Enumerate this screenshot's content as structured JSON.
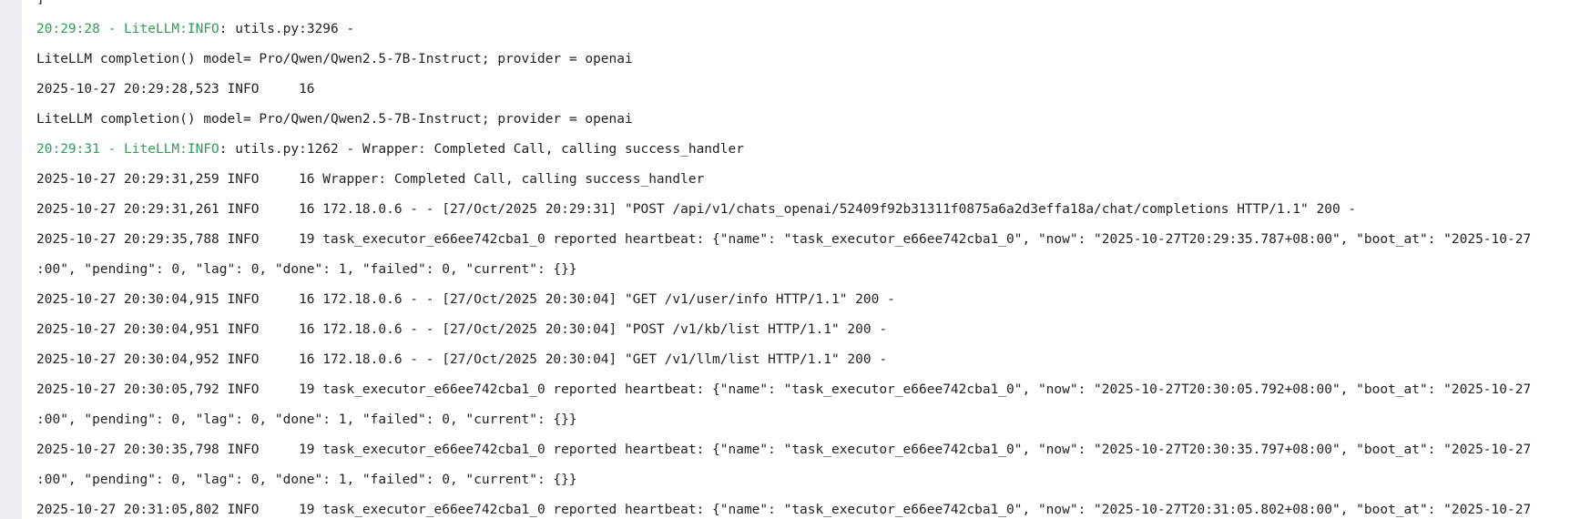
{
  "log": {
    "top_fragment": "]",
    "accent_color": "#2e9e5b",
    "lines": [
      {
        "prefix": "20:29:28 - LiteLLM:INFO",
        "text": ": utils.py:3296 -"
      },
      {
        "prefix": "",
        "text": "LiteLLM completion() model= Pro/Qwen/Qwen2.5-7B-Instruct; provider = openai"
      },
      {
        "prefix": "",
        "text": "2025-10-27 20:29:28,523 INFO     16"
      },
      {
        "prefix": "",
        "text": "LiteLLM completion() model= Pro/Qwen/Qwen2.5-7B-Instruct; provider = openai"
      },
      {
        "prefix": "20:29:31 - LiteLLM:INFO",
        "text": ": utils.py:1262 - Wrapper: Completed Call, calling success_handler"
      },
      {
        "prefix": "",
        "text": "2025-10-27 20:29:31,259 INFO     16 Wrapper: Completed Call, calling success_handler"
      },
      {
        "prefix": "",
        "text": "2025-10-27 20:29:31,261 INFO     16 172.18.0.6 - - [27/Oct/2025 20:29:31] \"POST /api/v1/chats_openai/52409f92b31311f0875a6a2d3effa18a/chat/completions HTTP/1.1\" 200 -"
      },
      {
        "prefix": "",
        "text": "2025-10-27 20:29:35,788 INFO     19 task_executor_e66ee742cba1_0 reported heartbeat: {\"name\": \"task_executor_e66ee742cba1_0\", \"now\": \"2025-10-27T20:29:35.787+08:00\", \"boot_at\": \"2025-10-27"
      },
      {
        "prefix": "",
        "text": ":00\", \"pending\": 0, \"lag\": 0, \"done\": 1, \"failed\": 0, \"current\": {}}"
      },
      {
        "prefix": "",
        "text": "2025-10-27 20:30:04,915 INFO     16 172.18.0.6 - - [27/Oct/2025 20:30:04] \"GET /v1/user/info HTTP/1.1\" 200 -"
      },
      {
        "prefix": "",
        "text": "2025-10-27 20:30:04,951 INFO     16 172.18.0.6 - - [27/Oct/2025 20:30:04] \"POST /v1/kb/list HTTP/1.1\" 200 -"
      },
      {
        "prefix": "",
        "text": "2025-10-27 20:30:04,952 INFO     16 172.18.0.6 - - [27/Oct/2025 20:30:04] \"GET /v1/llm/list HTTP/1.1\" 200 -"
      },
      {
        "prefix": "",
        "text": "2025-10-27 20:30:05,792 INFO     19 task_executor_e66ee742cba1_0 reported heartbeat: {\"name\": \"task_executor_e66ee742cba1_0\", \"now\": \"2025-10-27T20:30:05.792+08:00\", \"boot_at\": \"2025-10-27"
      },
      {
        "prefix": "",
        "text": ":00\", \"pending\": 0, \"lag\": 0, \"done\": 1, \"failed\": 0, \"current\": {}}"
      },
      {
        "prefix": "",
        "text": "2025-10-27 20:30:35,798 INFO     19 task_executor_e66ee742cba1_0 reported heartbeat: {\"name\": \"task_executor_e66ee742cba1_0\", \"now\": \"2025-10-27T20:30:35.797+08:00\", \"boot_at\": \"2025-10-27"
      },
      {
        "prefix": "",
        "text": ":00\", \"pending\": 0, \"lag\": 0, \"done\": 1, \"failed\": 0, \"current\": {}}"
      },
      {
        "prefix": "",
        "text": "2025-10-27 20:31:05,802 INFO     19 task_executor_e66ee742cba1_0 reported heartbeat: {\"name\": \"task_executor_e66ee742cba1_0\", \"now\": \"2025-10-27T20:31:05.802+08:00\", \"boot_at\": \"2025-10-27"
      }
    ]
  }
}
